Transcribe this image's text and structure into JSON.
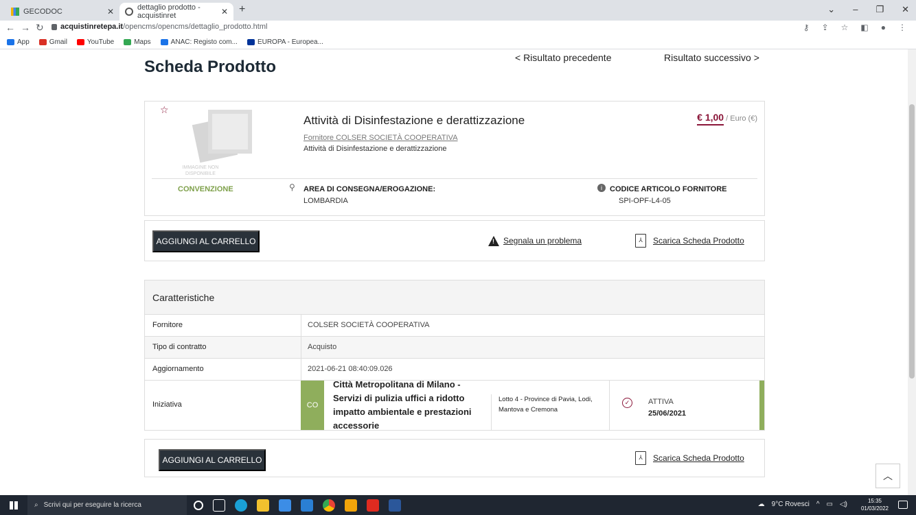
{
  "browser": {
    "tabs": [
      {
        "title": "GECODOC"
      },
      {
        "title": "dettaglio prodotto - acquistinret"
      }
    ],
    "url_domain": "acquistinretepa.it",
    "url_path": "/opencms/opencms/dettaglio_prodotto.html",
    "bookmarks": [
      {
        "label": "App",
        "color": "#1a73e8"
      },
      {
        "label": "Gmail",
        "color": "#d93025"
      },
      {
        "label": "YouTube",
        "color": "#ff0000"
      },
      {
        "label": "Maps",
        "color": "#34a853"
      },
      {
        "label": "ANAC: Registo com...",
        "color": "#1a73e8"
      },
      {
        "label": "EUROPA - Europea...",
        "color": "#003399"
      }
    ]
  },
  "page": {
    "title": "Scheda Prodotto",
    "prev_label": "< Risultato precedente",
    "next_label": "Risultato successivo >",
    "product": {
      "name": "Attività di Disinfestazione e derattizzazione",
      "supplier_link": "Fornitore COLSER SOCIETÀ COOPERATIVA",
      "description": "Attività di Disinfestazione e derattizzazione",
      "price": "€ 1,00",
      "price_unit": " / Euro (€)",
      "image_placeholder": "IMMAGINE NON DISPONIBILE",
      "type_label": "CONVENZIONE",
      "area_label": "AREA DI CONSEGNA/EROGAZIONE:",
      "area_value": "LOMBARDIA",
      "code_label": "CODICE ARTICOLO FORNITORE",
      "code_value": "SPI-OPF-L4-05"
    },
    "actions": {
      "add_to_cart": "AGGIUNGI AL CARRELLO",
      "report_problem": "Segnala un problema",
      "download_sheet": "Scarica Scheda Prodotto"
    },
    "characteristics": {
      "title": "Caratteristiche",
      "rows": [
        {
          "key": "Fornitore",
          "value": "COLSER SOCIETÀ COOPERATIVA"
        },
        {
          "key": "Tipo di contratto",
          "value": "Acquisto"
        },
        {
          "key": "Aggiornamento",
          "value": "2021-06-21 08:40:09.026"
        }
      ],
      "initiative": {
        "key": "Iniziativa",
        "badge": "CO",
        "name": "Città Metropolitana di Milano - Servizi di pulizia uffici a ridotto impatto ambientale e prestazioni accessorie",
        "lot": "Lotto 4 - Province di Pavia, Lodi, Mantova e Cremona",
        "status": "ATTIVA",
        "date": "25/06/2021"
      }
    }
  },
  "taskbar": {
    "search_placeholder": "Scrivi qui per eseguire la ricerca",
    "weather": "9°C Rovesci",
    "time": "15:35",
    "date": "01/03/2022"
  },
  "colors": {
    "accent_maroon": "#8a1538",
    "green": "#8fae5c",
    "dark_button": "#2a323a"
  }
}
